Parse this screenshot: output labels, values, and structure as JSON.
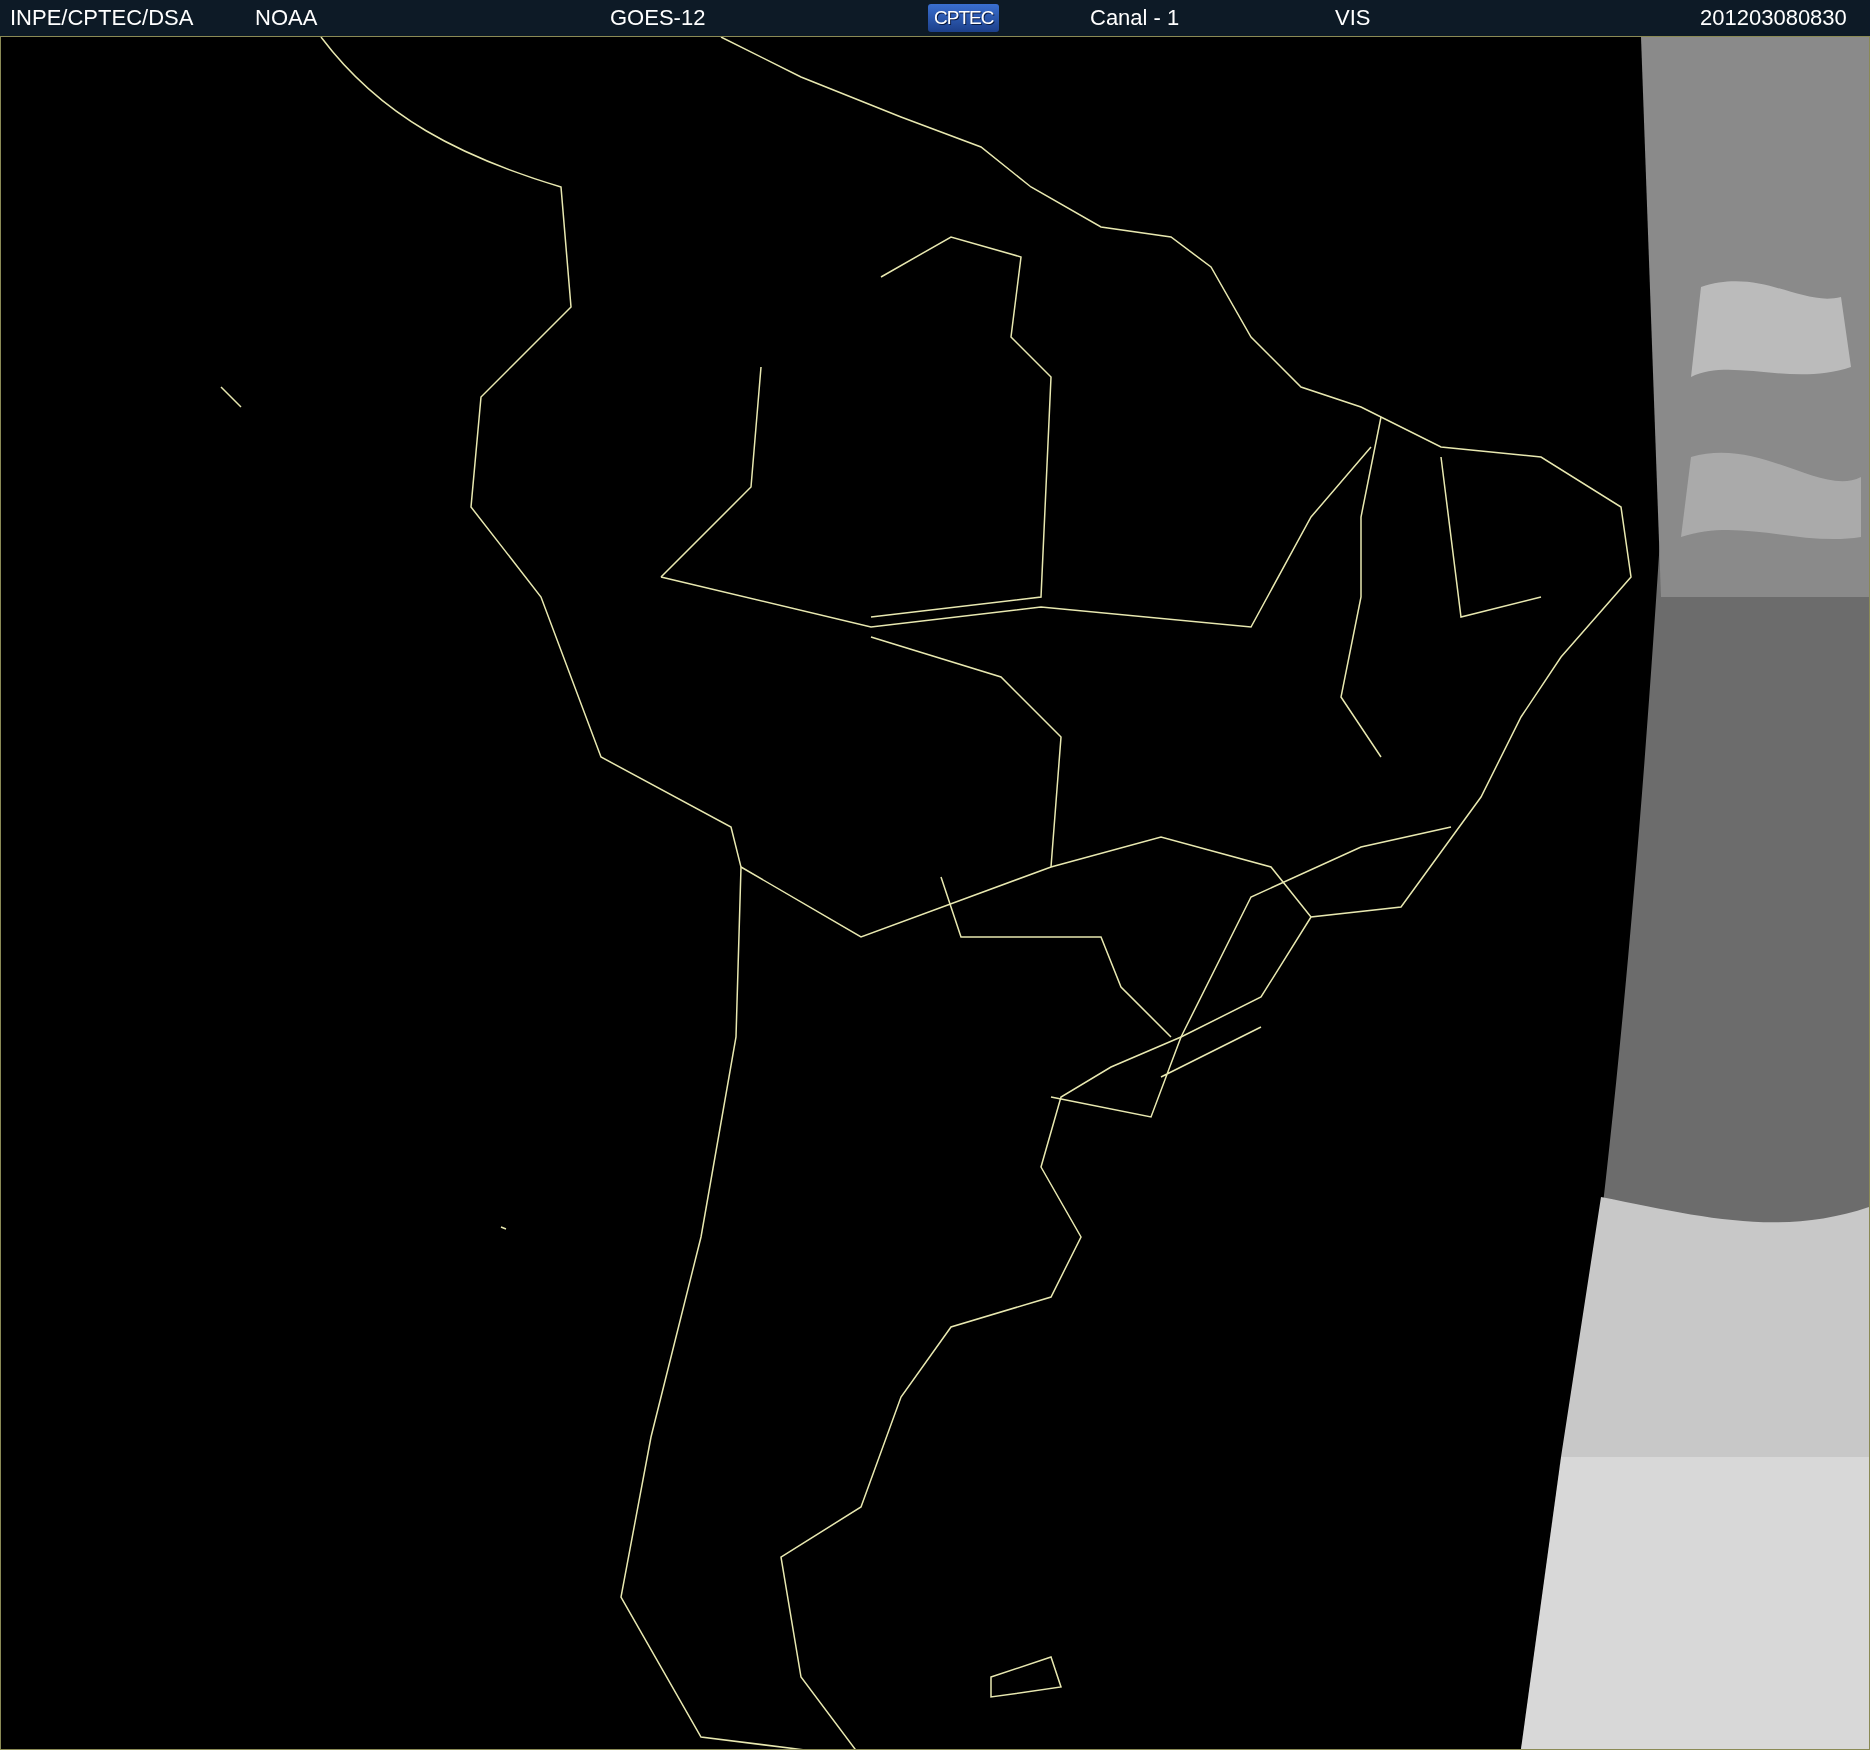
{
  "header": {
    "items": [
      {
        "kind": "text",
        "text": "INPE/CPTEC/DSA"
      },
      {
        "kind": "text",
        "text": "NOAA"
      },
      {
        "kind": "text",
        "text": "GOES-12"
      },
      {
        "kind": "logo",
        "text": "CPTEC"
      },
      {
        "kind": "text",
        "text": "Canal - 1"
      },
      {
        "kind": "text",
        "text": "VIS"
      },
      {
        "kind": "text",
        "text": "201203080830"
      }
    ]
  }
}
